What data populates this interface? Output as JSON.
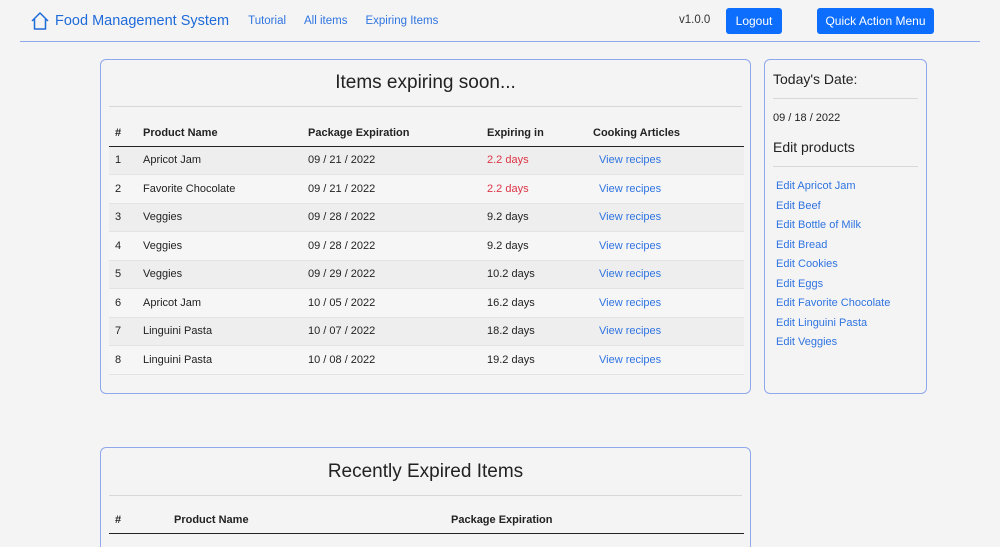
{
  "nav": {
    "brand": "Food Management System",
    "links": [
      "Tutorial",
      "All items",
      "Expiring Items"
    ],
    "version": "v1.0.0",
    "logout": "Logout",
    "quick_action": "Quick Action Menu"
  },
  "expiring": {
    "title": "Items expiring soon...",
    "headers": [
      "#",
      "Product Name",
      "Package Expiration",
      "Expiring in",
      "Cooking Articles"
    ],
    "rows": [
      {
        "num": "1",
        "name": "Apricot Jam",
        "exp": "09 / 21 / 2022",
        "in": "2.2 days",
        "link": "View recipes",
        "urgent": true
      },
      {
        "num": "2",
        "name": "Favorite Chocolate",
        "exp": "09 / 21 / 2022",
        "in": "2.2 days",
        "link": "View recipes",
        "urgent": true
      },
      {
        "num": "3",
        "name": "Veggies",
        "exp": "09 / 28 / 2022",
        "in": "9.2 days",
        "link": "View recipes",
        "urgent": false
      },
      {
        "num": "4",
        "name": "Veggies",
        "exp": "09 / 28 / 2022",
        "in": "9.2 days",
        "link": "View recipes",
        "urgent": false
      },
      {
        "num": "5",
        "name": "Veggies",
        "exp": "09 / 29 / 2022",
        "in": "10.2 days",
        "link": "View recipes",
        "urgent": false
      },
      {
        "num": "6",
        "name": "Apricot Jam",
        "exp": "10 / 05 / 2022",
        "in": "16.2 days",
        "link": "View recipes",
        "urgent": false
      },
      {
        "num": "7",
        "name": "Linguini Pasta",
        "exp": "10 / 07 / 2022",
        "in": "18.2 days",
        "link": "View recipes",
        "urgent": false
      },
      {
        "num": "8",
        "name": "Linguini Pasta",
        "exp": "10 / 08 / 2022",
        "in": "19.2 days",
        "link": "View recipes",
        "urgent": false
      }
    ]
  },
  "side": {
    "date_heading": "Today's Date:",
    "date": "09 / 18 / 2022",
    "edit_heading": "Edit products",
    "edit_links": [
      "Edit Apricot Jam",
      "Edit Beef",
      "Edit Bottle of Milk",
      "Edit Bread",
      "Edit Cookies",
      "Edit Eggs",
      "Edit Favorite Chocolate",
      "Edit Linguini Pasta",
      "Edit Veggies"
    ]
  },
  "expired": {
    "title": "Recently Expired Items",
    "headers": [
      "#",
      "Product Name",
      "Package Expiration"
    ]
  },
  "colors": {
    "accent": "#0d6efd",
    "link": "#2f74e0",
    "danger": "#dc3545",
    "border": "#8fa8ec"
  }
}
